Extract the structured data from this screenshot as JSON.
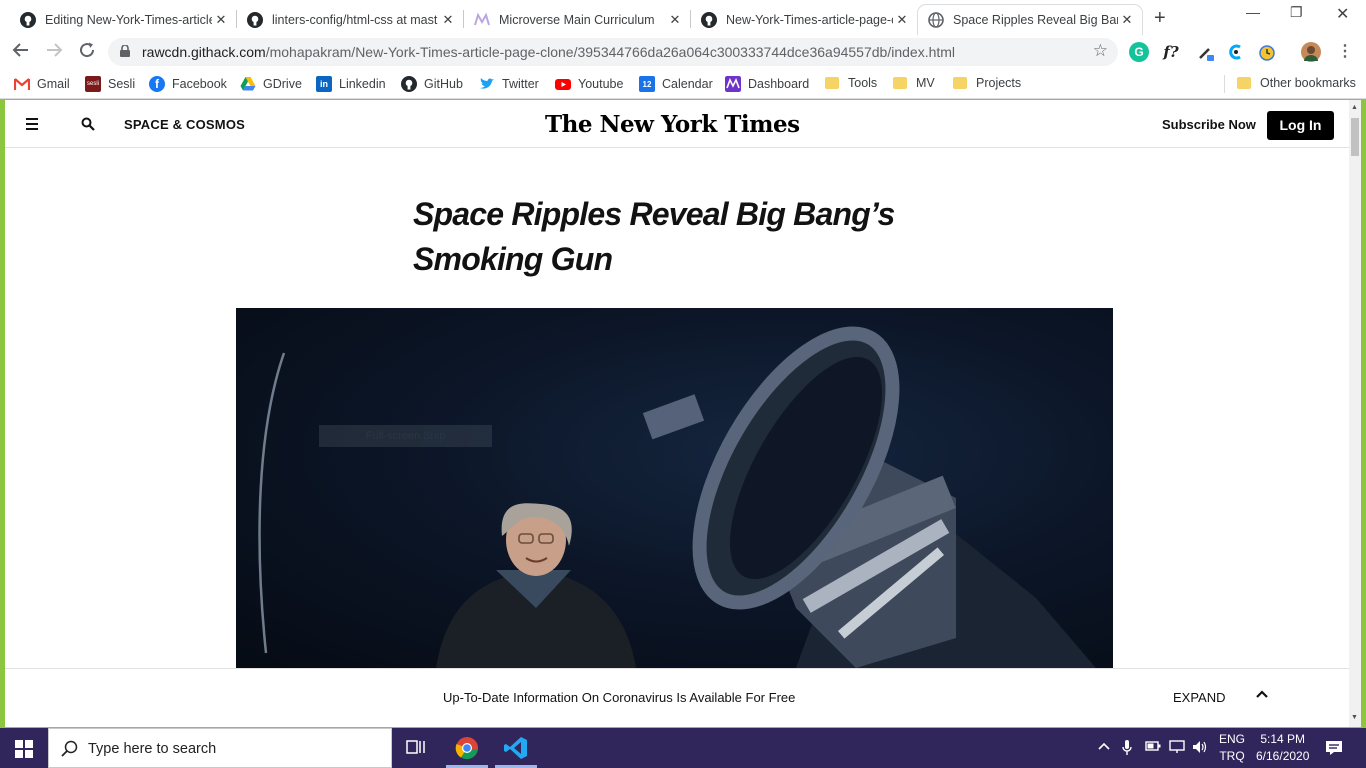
{
  "browser": {
    "tabs": [
      {
        "title": "Editing New-York-Times-article"
      },
      {
        "title": "linters-config/html-css at mast"
      },
      {
        "title": "Microverse Main Curriculum"
      },
      {
        "title": "New-York-Times-article-page-c"
      },
      {
        "title": "Space Ripples Reveal Big Bang"
      }
    ],
    "url_host": "rawcdn.githack.com",
    "url_path": "/mohapakram/New-York-Times-article-page-clone/395344766da26a064c300333744dce36a94557db/index.html",
    "bookmarks": [
      {
        "label": "Gmail",
        "icon": "gmail-icon"
      },
      {
        "label": "Sesli",
        "icon": "sesli-icon"
      },
      {
        "label": "Facebook",
        "icon": "facebook-icon"
      },
      {
        "label": "GDrive",
        "icon": "gdrive-icon"
      },
      {
        "label": "Linkedin",
        "icon": "linkedin-icon"
      },
      {
        "label": "GitHub",
        "icon": "github-icon"
      },
      {
        "label": "Twitter",
        "icon": "twitter-icon"
      },
      {
        "label": "Youtube",
        "icon": "youtube-icon"
      },
      {
        "label": "Calendar",
        "icon": "calendar-icon"
      },
      {
        "label": "Dashboard",
        "icon": "dashboard-icon"
      },
      {
        "label": "Tools",
        "icon": "folder-icon"
      },
      {
        "label": "MV",
        "icon": "folder-icon"
      },
      {
        "label": "Projects",
        "icon": "folder-icon"
      }
    ],
    "other_bookmarks": "Other bookmarks",
    "sesli_badge": "sesli",
    "calendar_badge": "12"
  },
  "nyt": {
    "section": "SPACE & COSMOS",
    "logo": "The New York Times",
    "subscribe": "Subscribe Now",
    "login": "Log In",
    "headline_line1": "Space Ripples Reveal Big Bang’s",
    "headline_line2": "Smoking Gun",
    "snip_overlay": "Full-screen Snip",
    "banner_message": "Up-To-Date Information On Coronavirus Is Available For Free",
    "banner_expand": "EXPAND"
  },
  "taskbar": {
    "search_placeholder": "Type here to search",
    "lang_top": "ENG",
    "lang_bottom": "TRQ",
    "time": "5:14 PM",
    "date": "6/16/2020"
  },
  "colors": {
    "chrome_bg": "#ffffff",
    "desktop_accent": "#8cc63f",
    "taskbar": "#31265c",
    "nyt_black": "#121212"
  }
}
